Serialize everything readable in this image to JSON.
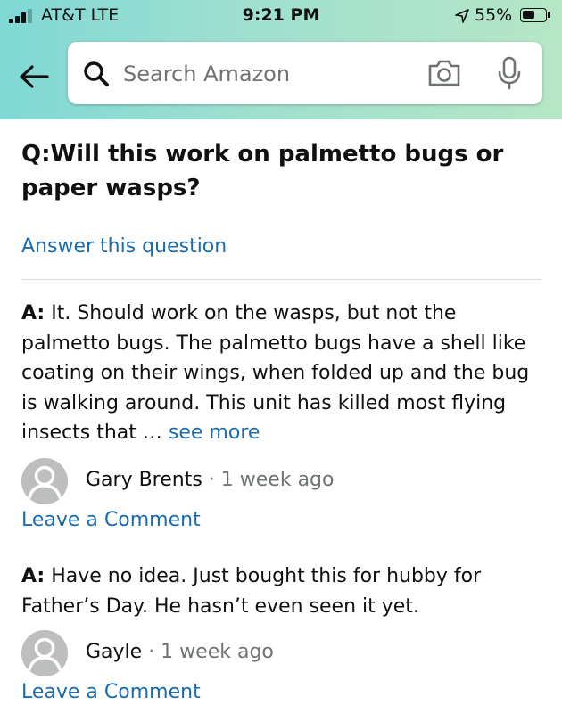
{
  "status_bar": {
    "carrier": "AT&T  LTE",
    "time": "9:21 PM",
    "battery_percent": "55%",
    "battery_level": 0.55,
    "signal_bars": 3
  },
  "search": {
    "placeholder": "Search Amazon",
    "value": ""
  },
  "icons": {
    "back": "arrow-left-icon",
    "search": "magnifier-icon",
    "camera": "camera-icon",
    "mic": "microphone-icon"
  },
  "question": {
    "text": "Q:Will this work on palmetto bugs or paper wasps?",
    "answer_link": "Answer this question"
  },
  "answers": [
    {
      "prefix": "A:",
      "text": " It. Should work on the wasps, but not the palmetto bugs. The palmetto bugs have a shell like coating on their wings, when folded up and the bug is walking around. This unit has killed most flying insects that … ",
      "see_more": "see more",
      "author": "Gary Brents",
      "meta": " · 1 week ago",
      "comment_link": "Leave a Comment"
    },
    {
      "prefix": "A:",
      "text": " Have no idea. Just bought this for hubby for Father’s Day. He hasn’t even seen it yet.",
      "author": "Gayle",
      "meta": " · 1 week ago",
      "comment_link": "Leave a Comment"
    }
  ],
  "colors": {
    "link": "#1a6bb0",
    "header_gradient_start": "#80d8d5",
    "header_gradient_end": "#b6e6c6"
  }
}
